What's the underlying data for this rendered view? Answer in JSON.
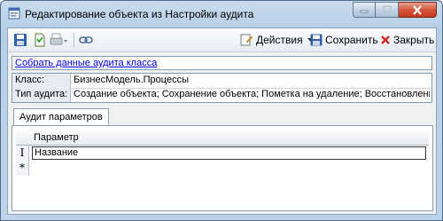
{
  "window": {
    "title": "Редактирование объекта из Настройки аудита"
  },
  "toolbar": {
    "actions_label": "Действия",
    "save_label": "Сохранить",
    "close_label": "Закрыть"
  },
  "link": {
    "collect_audit_data": "Собрать данные аудита класса"
  },
  "properties": {
    "class_label": "Класс:",
    "class_value": "БизнесМодель.Процессы",
    "audit_type_label": "Тип аудита:",
    "audit_type_value": "Создание объекта; Сохранение объекта; Пометка на удаление; Восстановление;"
  },
  "tabs": [
    {
      "label": "Аудит параметров",
      "selected": true
    }
  ],
  "grid": {
    "column_header": "Параметр",
    "rows": [
      {
        "marker": "I",
        "value": "Название"
      }
    ],
    "new_row_marker": "*"
  }
}
